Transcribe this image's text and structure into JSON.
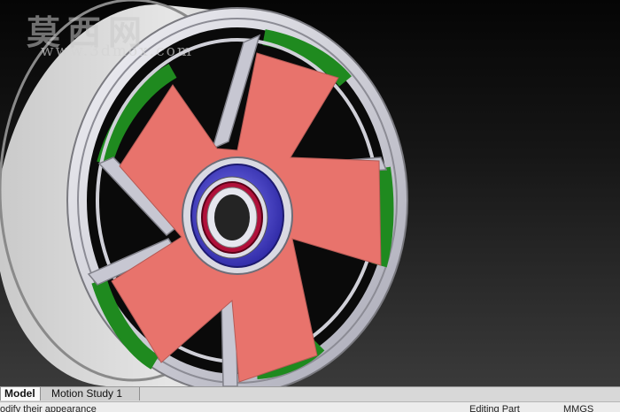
{
  "watermark": {
    "text": "莫西网",
    "url": "www.3dmox.com"
  },
  "tabs": [
    {
      "label": "Model",
      "active": true
    },
    {
      "label": "Motion Study 1",
      "active": false
    }
  ],
  "status": {
    "hint": "odify their appearance",
    "mode": "Editing Part",
    "units": "MMGS"
  },
  "colors": {
    "rim": "#d9d9e2",
    "fan": "#e8736c",
    "green_segments": "#1f8a1f",
    "bearing_outer": "#4b46d6",
    "bearing_inner": "#b0103a"
  },
  "icons": {
    "model": "part-model-icon"
  }
}
